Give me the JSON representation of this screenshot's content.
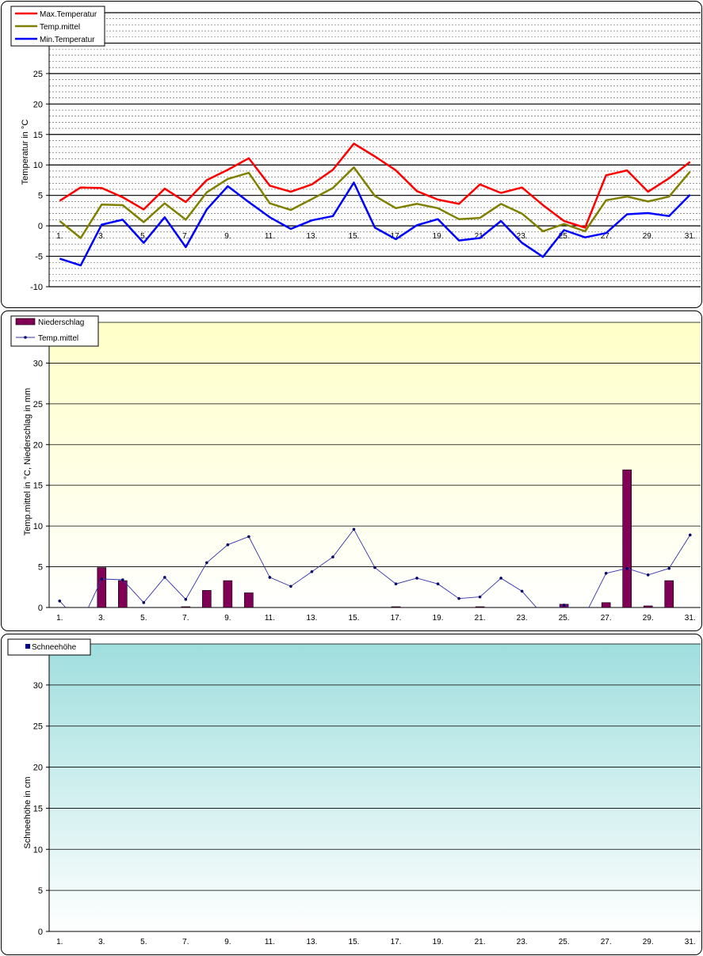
{
  "x_tick_labels": [
    "1.",
    "3.",
    "5.",
    "7.",
    "9.",
    "11.",
    "13.",
    "15.",
    "17.",
    "19.",
    "21.",
    "23.",
    "25.",
    "27.",
    "29.",
    "31."
  ],
  "chart_data": [
    {
      "type": "line",
      "ylabel": "Temperatur  in °C",
      "ylim": [
        -10,
        35
      ],
      "y_ticks": [
        -10,
        -5,
        0,
        5,
        10,
        15,
        20,
        25
      ],
      "grid": true,
      "legend_position": "top-left",
      "categories": [
        1,
        2,
        3,
        4,
        5,
        6,
        7,
        8,
        9,
        10,
        11,
        12,
        13,
        14,
        15,
        16,
        17,
        18,
        19,
        20,
        21,
        22,
        23,
        24,
        25,
        26,
        27,
        28,
        29,
        30,
        31
      ],
      "series": [
        {
          "name": "Max.Temperatur",
          "color": "#ff0000",
          "values": [
            4.1,
            6.3,
            6.2,
            4.7,
            2.7,
            6.1,
            3.9,
            7.5,
            9.2,
            11.1,
            6.6,
            5.6,
            6.8,
            9.2,
            13.5,
            11.4,
            9.1,
            5.7,
            4.3,
            3.6,
            6.8,
            5.4,
            6.3,
            3.4,
            0.8,
            -0.3,
            8.3,
            9.1,
            5.6,
            7.8,
            10.5
          ]
        },
        {
          "name": "Temp.mittel",
          "color": "#808000",
          "values": [
            0.8,
            -2.0,
            3.5,
            3.4,
            0.6,
            3.7,
            1.0,
            5.5,
            7.7,
            8.7,
            3.7,
            2.6,
            4.4,
            6.2,
            9.6,
            4.9,
            2.9,
            3.6,
            2.9,
            1.1,
            1.3,
            3.6,
            2.0,
            -0.9,
            0.3,
            -0.9,
            4.2,
            4.8,
            4.0,
            4.8,
            8.9
          ]
        },
        {
          "name": "Min.Temperatur",
          "color": "#0000ff",
          "values": [
            -5.4,
            -6.5,
            0.2,
            1.0,
            -2.8,
            1.4,
            -3.5,
            2.7,
            6.5,
            3.9,
            1.4,
            -0.5,
            0.9,
            1.6,
            7.1,
            -0.3,
            -2.2,
            0.1,
            1.1,
            -2.4,
            -2.0,
            0.8,
            -2.8,
            -5.1,
            -0.7,
            -1.9,
            -1.2,
            1.9,
            2.1,
            1.6,
            5.1
          ]
        }
      ]
    },
    {
      "type": "bar",
      "ylabel": "Temp.mittel  in °C, Niederschlag  in mm",
      "ylim": [
        0,
        35
      ],
      "y_ticks": [
        0,
        5,
        10,
        15,
        20,
        25,
        30
      ],
      "grid": true,
      "legend_position": "top-left",
      "categories": [
        1,
        2,
        3,
        4,
        5,
        6,
        7,
        8,
        9,
        10,
        11,
        12,
        13,
        14,
        15,
        16,
        17,
        18,
        19,
        20,
        21,
        22,
        23,
        24,
        25,
        26,
        27,
        28,
        29,
        30,
        31
      ],
      "series": [
        {
          "name": "Niederschlag",
          "type": "bar",
          "color": "#800055",
          "values": [
            0,
            0,
            4.9,
            3.3,
            0,
            0,
            0.1,
            2.1,
            3.3,
            1.8,
            0,
            0,
            0,
            0,
            0,
            0,
            0.1,
            0,
            0,
            0,
            0.1,
            0,
            0,
            0,
            0.4,
            0,
            0.6,
            16.9,
            0.2,
            3.3,
            0
          ]
        },
        {
          "name": "Temp.mittel",
          "type": "line",
          "color": "#3333aa",
          "values": [
            0.8,
            -2.0,
            3.5,
            3.4,
            0.6,
            3.7,
            1.0,
            5.5,
            7.7,
            8.7,
            3.7,
            2.6,
            4.4,
            6.2,
            9.6,
            4.9,
            2.9,
            3.6,
            2.9,
            1.1,
            1.3,
            3.6,
            2.0,
            -0.9,
            0.3,
            -0.9,
            4.2,
            4.8,
            4.0,
            4.8,
            8.9
          ]
        }
      ]
    },
    {
      "type": "bar",
      "ylabel": "Schneehöhe in cm",
      "ylim": [
        0,
        35
      ],
      "y_ticks": [
        0,
        5,
        10,
        15,
        20,
        25,
        30
      ],
      "grid": true,
      "legend_position": "top-left",
      "categories": [
        1,
        2,
        3,
        4,
        5,
        6,
        7,
        8,
        9,
        10,
        11,
        12,
        13,
        14,
        15,
        16,
        17,
        18,
        19,
        20,
        21,
        22,
        23,
        24,
        25,
        26,
        27,
        28,
        29,
        30,
        31
      ],
      "series": [
        {
          "name": "Schneehöhe",
          "type": "bar",
          "color": "#000080",
          "values": [
            0,
            0,
            0,
            0,
            0,
            0,
            0,
            0,
            0,
            0,
            0,
            0,
            0,
            0,
            0,
            0,
            0,
            0,
            0,
            0,
            0,
            0,
            0,
            0,
            0,
            0,
            0,
            0,
            0,
            0,
            0
          ]
        }
      ]
    }
  ],
  "colors": {
    "chart2_bg_top": "#ffffc8",
    "chart2_bg_bottom": "#ffffff",
    "chart3_bg_top": "#a0dede",
    "chart3_bg_bottom": "#ffffff"
  }
}
